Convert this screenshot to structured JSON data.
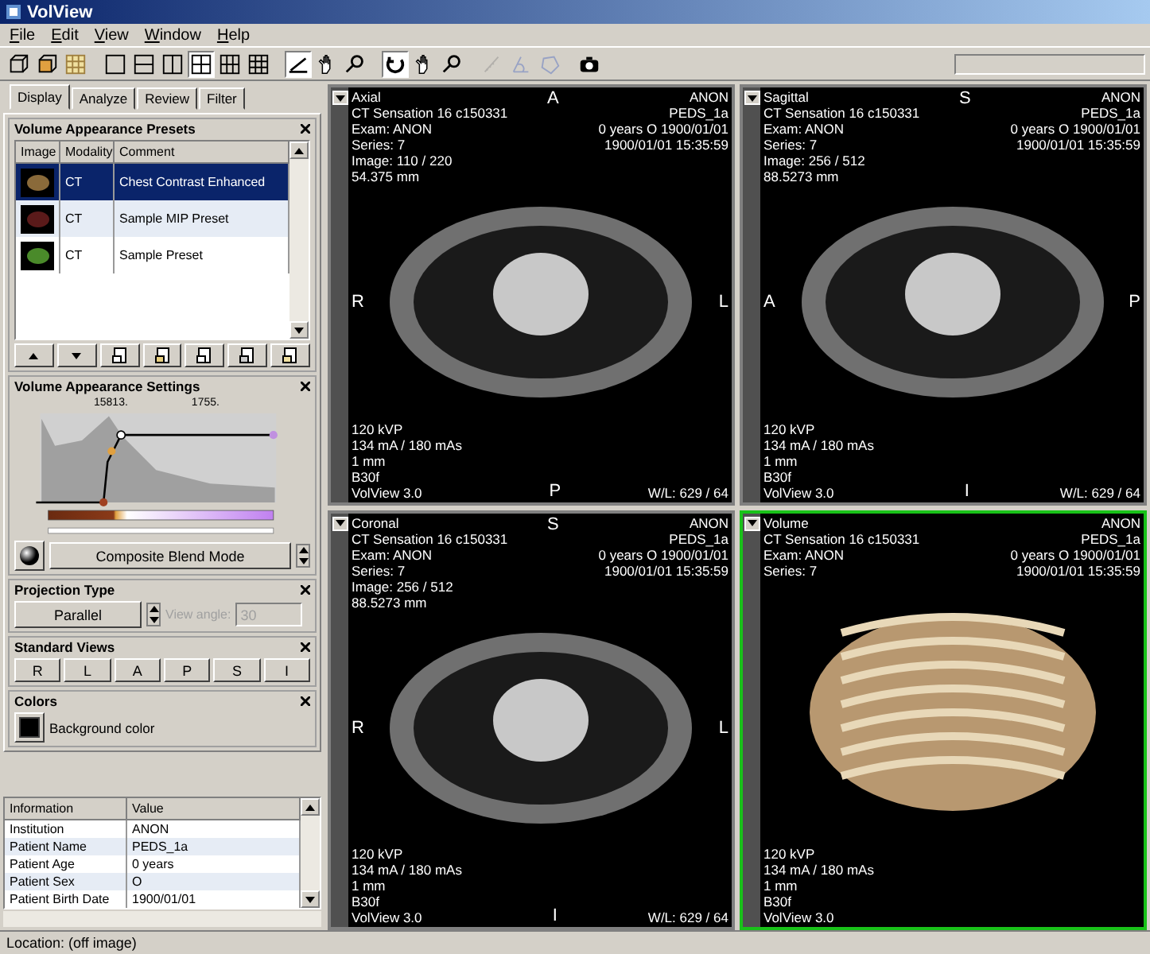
{
  "window": {
    "title": "VolView"
  },
  "menu": [
    "File",
    "Edit",
    "View",
    "Window",
    "Help"
  ],
  "toolbar": [
    {
      "pressed": false,
      "disabled": false
    },
    {
      "pressed": false,
      "disabled": false
    },
    {
      "pressed": false,
      "disabled": false
    },
    {
      "pressed": false,
      "disabled": false
    },
    {
      "pressed": false,
      "disabled": false
    },
    {
      "pressed": false,
      "disabled": false
    },
    {
      "pressed": true,
      "disabled": false
    },
    {
      "pressed": false,
      "disabled": false
    },
    {
      "pressed": false,
      "disabled": false
    },
    {
      "pressed": true,
      "disabled": false
    },
    {
      "pressed": false,
      "disabled": false
    },
    {
      "pressed": false,
      "disabled": false
    },
    {
      "pressed": true,
      "disabled": false
    },
    {
      "pressed": false,
      "disabled": false
    },
    {
      "pressed": false,
      "disabled": false
    },
    {
      "pressed": false,
      "disabled": true
    },
    {
      "pressed": false,
      "disabled": true
    },
    {
      "pressed": false,
      "disabled": true
    },
    {
      "pressed": false,
      "disabled": false
    }
  ],
  "tabs": [
    {
      "label": "Display",
      "selected": true
    },
    {
      "label": "Analyze",
      "selected": false
    },
    {
      "label": "Review",
      "selected": false
    },
    {
      "label": "Filter",
      "selected": false
    }
  ],
  "presets": {
    "title": "Volume Appearance Presets",
    "columns": [
      "Image",
      "Modality",
      "Comment"
    ],
    "rows": [
      {
        "modality": "CT",
        "comment": "Chest Contrast Enhanced",
        "selected": true,
        "color": "#8a6a3a"
      },
      {
        "modality": "CT",
        "comment": "Sample MIP Preset",
        "selected": false,
        "color": "#5a1a1a"
      },
      {
        "modality": "CT",
        "comment": "Sample Preset",
        "selected": false,
        "color": "#4a8a2a"
      }
    ]
  },
  "settings": {
    "title": "Volume Appearance Settings",
    "markers": [
      "15813.",
      "1755."
    ],
    "blend_mode": "Composite Blend Mode"
  },
  "projection": {
    "title": "Projection Type",
    "value": "Parallel",
    "angle_label": "View angle:",
    "angle_value": "30",
    "angle_disabled": true
  },
  "standard_views": {
    "title": "Standard Views",
    "buttons": [
      "R",
      "L",
      "A",
      "P",
      "S",
      "I"
    ]
  },
  "colors": {
    "title": "Colors",
    "label": "Background color"
  },
  "info": {
    "columns": [
      "Information",
      "Value"
    ],
    "rows": [
      [
        "Institution",
        "ANON"
      ],
      [
        "Patient Name",
        "PEDS_1a"
      ],
      [
        "Patient Age",
        "0 years"
      ],
      [
        "Patient Sex",
        "O"
      ],
      [
        "Patient Birth Date",
        "1900/01/01"
      ]
    ]
  },
  "viewports": [
    {
      "kind": "slice",
      "selected": false,
      "top_left": [
        "Axial",
        "CT Sensation 16 c150331",
        "Exam: ANON",
        "Series: 7",
        "Image: 110 / 220",
        "54.375 mm"
      ],
      "top_right": [
        "ANON",
        "PEDS_1a",
        "0 years O 1900/01/01",
        "1900/01/01 15:35:59"
      ],
      "top": "A",
      "left": "R",
      "right": "L",
      "bottom": "P",
      "bottom_left": [
        "120 kVP",
        "134 mA / 180 mAs",
        "1  mm",
        "B30f",
        "VolView 3.0"
      ],
      "bottom_right": "W/L: 629 / 64"
    },
    {
      "kind": "slice",
      "selected": false,
      "top_left": [
        "Sagittal",
        "CT Sensation 16 c150331",
        "Exam: ANON",
        "Series: 7",
        "Image: 256 / 512",
        "88.5273 mm"
      ],
      "top_right": [
        "ANON",
        "PEDS_1a",
        "0 years O 1900/01/01",
        "1900/01/01 15:35:59"
      ],
      "top": "S",
      "left": "A",
      "right": "P",
      "bottom": "I",
      "bottom_left": [
        "120 kVP",
        "134 mA / 180 mAs",
        "1  mm",
        "B30f",
        "VolView 3.0"
      ],
      "bottom_right": "W/L: 629 / 64"
    },
    {
      "kind": "slice",
      "selected": false,
      "top_left": [
        "Coronal",
        "CT Sensation 16 c150331",
        "Exam: ANON",
        "Series: 7",
        "Image: 256 / 512",
        "88.5273 mm"
      ],
      "top_right": [
        "ANON",
        "PEDS_1a",
        "0 years O 1900/01/01",
        "1900/01/01 15:35:59"
      ],
      "top": "S",
      "left": "R",
      "right": "L",
      "bottom": "I",
      "bottom_left": [
        "120 kVP",
        "134 mA / 180 mAs",
        "1  mm",
        "B30f",
        "VolView 3.0"
      ],
      "bottom_right": "W/L: 629 / 64"
    },
    {
      "kind": "volume",
      "selected": true,
      "top_left": [
        "Volume",
        "CT Sensation 16 c150331",
        "Exam: ANON",
        "Series: 7"
      ],
      "top_right": [
        "ANON",
        "PEDS_1a",
        "0 years O 1900/01/01",
        "1900/01/01 15:35:59"
      ],
      "bottom_left": [
        "120 kVP",
        "134 mA / 180 mAs",
        "1  mm",
        "B30f",
        "VolView 3.0"
      ]
    }
  ],
  "status_bar": "Location: (off image)"
}
